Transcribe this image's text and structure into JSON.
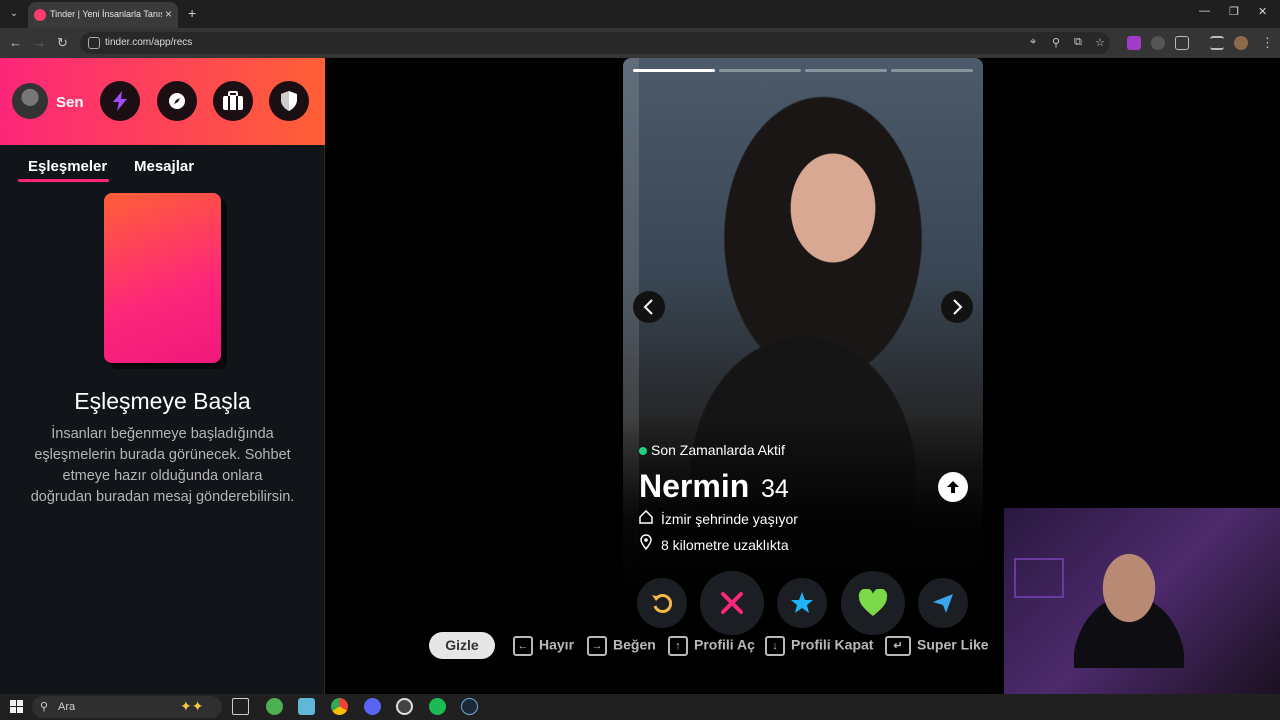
{
  "browser": {
    "tab_title": "Tinder | Yeni İnsanlarla Tanış, Bu",
    "url": "tinder.com/app/recs"
  },
  "sidebar": {
    "user_label": "Sen",
    "tabs": [
      {
        "label": "Eşleşmeler",
        "active": true
      },
      {
        "label": "Mesajlar",
        "active": false
      }
    ],
    "empty_title": "Eşleşmeye Başla",
    "empty_desc": "İnsanları beğenmeye başladığında eşleşmelerin burada görünecek. Sohbet etmeye hazır olduğunda onlara doğrudan buradan mesaj gönderebilirsin."
  },
  "profile": {
    "photo_count": 4,
    "active_photo": 1,
    "status": "Son Zamanlarda Aktif",
    "name": "Nermin",
    "age": "34",
    "city": "İzmir şehrinde yaşıyor",
    "distance": "8 kilometre uzaklıkta"
  },
  "actions": [
    {
      "name": "rewind",
      "color": "#f5b748"
    },
    {
      "name": "nope",
      "color": "#fd267a"
    },
    {
      "name": "super-like",
      "color": "#1fb4f6"
    },
    {
      "name": "like",
      "color": "#7cd94a"
    },
    {
      "name": "boost",
      "color": "#3ba6f0"
    }
  ],
  "shortcuts": {
    "hide_label": "Gizle",
    "items": [
      "Hayır",
      "Beğen",
      "Profili Aç",
      "Profili Kapat",
      "Super Like"
    ]
  },
  "taskbar": {
    "search_placeholder": "Ara"
  },
  "colors": {
    "brand_start": "#fd267a",
    "brand_end": "#ff6036",
    "online": "#21d07c"
  }
}
